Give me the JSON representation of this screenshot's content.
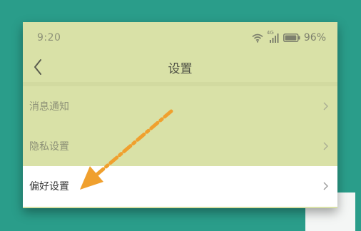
{
  "status_bar": {
    "time": "9:20",
    "signal_label": "4G",
    "battery_text": "96%",
    "battery_level": 0.96
  },
  "navbar": {
    "title": "设置"
  },
  "settings_list": {
    "items": [
      {
        "label": "消息通知",
        "selected": false
      },
      {
        "label": "隐私设置",
        "selected": false
      },
      {
        "label": "偏好设置",
        "selected": true
      }
    ]
  },
  "annotation": {
    "arrow_color": "#f0a02e",
    "icon": "dashed-pointer-arrow"
  },
  "colors": {
    "background": "#2a9d8a",
    "screen_overlay": "#d9e1a7",
    "selected_row": "#ffffff"
  }
}
